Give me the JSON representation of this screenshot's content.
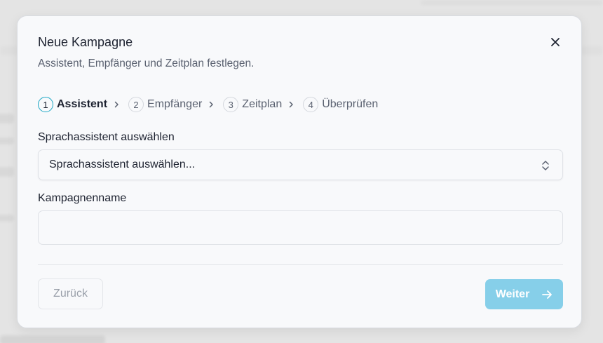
{
  "dialog": {
    "title": "Neue Kampagne",
    "subtitle": "Assistent, Empfänger und Zeitplan festlegen."
  },
  "stepper": {
    "steps": [
      {
        "number": "1",
        "label": "Assistent",
        "active": true
      },
      {
        "number": "2",
        "label": "Empfänger",
        "active": false
      },
      {
        "number": "3",
        "label": "Zeitplan",
        "active": false
      },
      {
        "number": "4",
        "label": "Überprüfen",
        "active": false
      }
    ]
  },
  "form": {
    "assistant_label": "Sprachassistent auswählen",
    "assistant_value": "Sprachassistent auswählen...",
    "name_label": "Kampagnenname",
    "name_value": ""
  },
  "footer": {
    "back_label": "Zurück",
    "next_label": "Weiter"
  },
  "colors": {
    "accent": "#1aa6c4",
    "next_button_bg": "#86cfe9"
  },
  "icons": {
    "close": "close-icon",
    "step_separator": "chevron-right-icon",
    "select": "chevron-up-down-icon",
    "next": "arrow-right-icon"
  }
}
